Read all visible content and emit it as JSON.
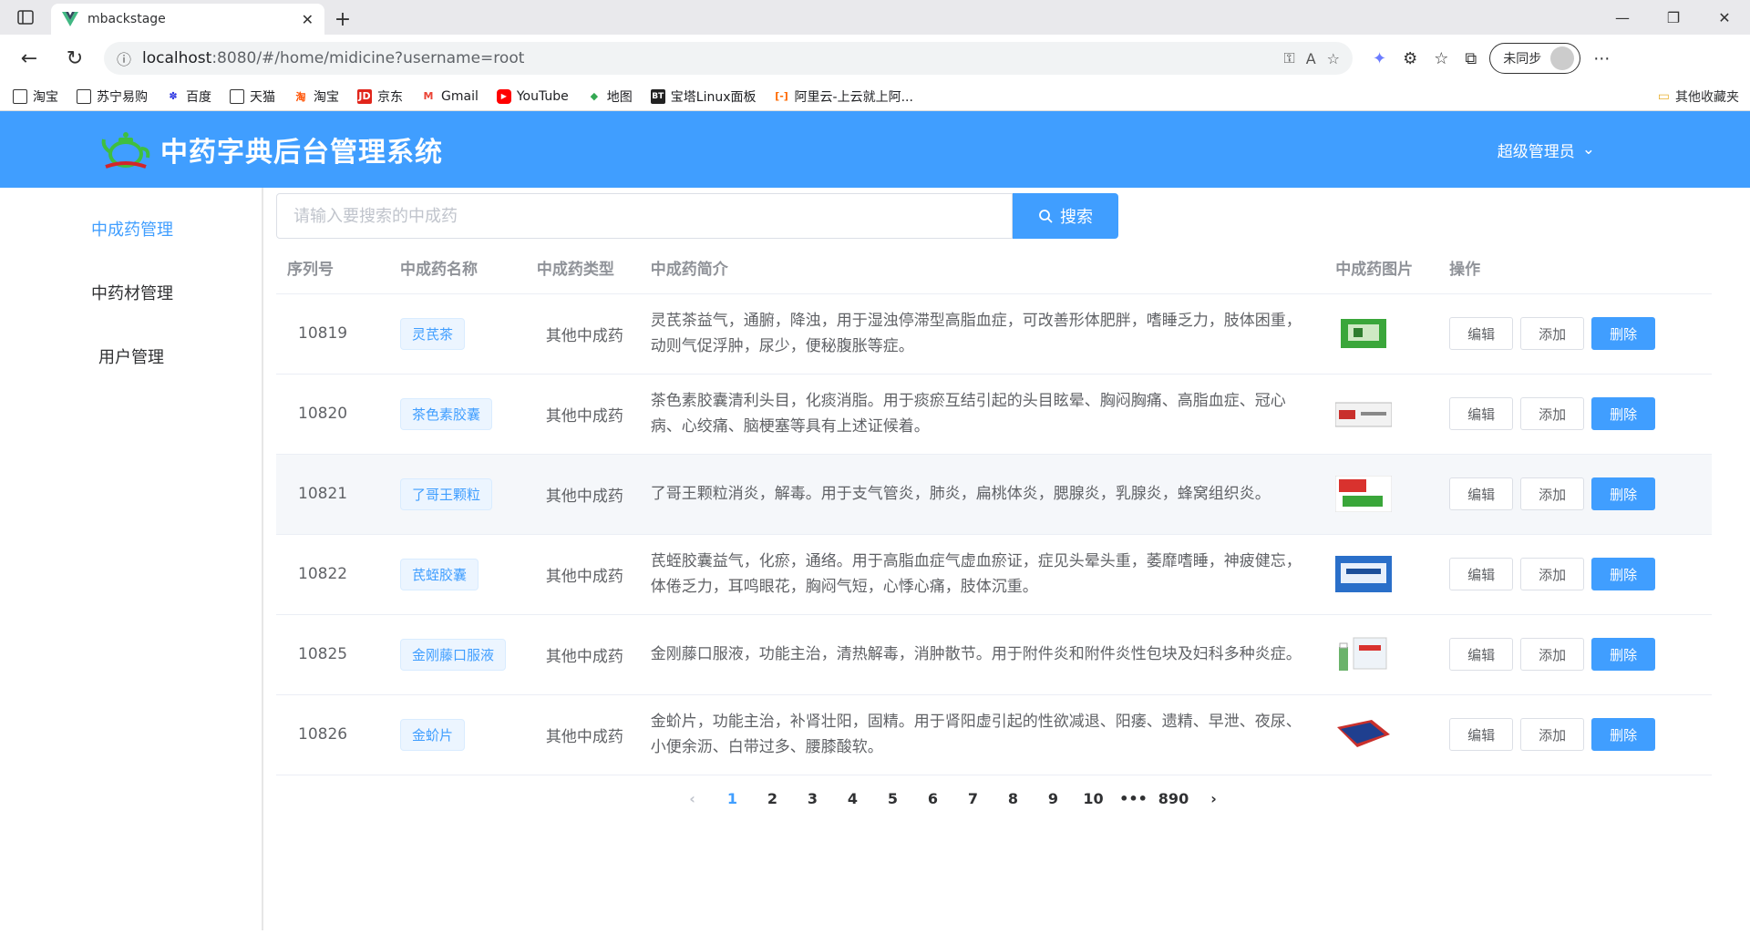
{
  "browser": {
    "tab_title": "mbackstage",
    "url_host": "localhost",
    "url_path": ":8080/#/home/midicine?username=root",
    "sync_label": "未同步",
    "bookmarks": [
      {
        "label": "淘宝",
        "icon": "page-icon"
      },
      {
        "label": "苏宁易购",
        "icon": "page-icon"
      },
      {
        "label": "百度",
        "icon": "baidu-icon"
      },
      {
        "label": "天猫",
        "icon": "page-icon"
      },
      {
        "label": "淘宝",
        "icon": "taobao-icon"
      },
      {
        "label": "京东",
        "icon": "jd-icon"
      },
      {
        "label": "Gmail",
        "icon": "gmail-icon"
      },
      {
        "label": "YouTube",
        "icon": "youtube-icon"
      },
      {
        "label": "地图",
        "icon": "map-icon"
      },
      {
        "label": "宝塔Linux面板",
        "icon": "bt-icon"
      },
      {
        "label": "阿里云-上云就上阿...",
        "icon": "aliyun-icon"
      }
    ],
    "other_bookmarks": "其他收藏夹"
  },
  "app": {
    "title": "中药字典后台管理系统",
    "user_menu": "超级管理员"
  },
  "sidebar": {
    "items": [
      {
        "label": "中成药管理",
        "active": true
      },
      {
        "label": "中药材管理",
        "active": false
      },
      {
        "label": "用户管理",
        "active": false
      }
    ]
  },
  "search": {
    "placeholder": "请输入要搜索的中成药",
    "button_label": "搜索"
  },
  "table": {
    "headers": [
      "序列号",
      "中成药名称",
      "中成药类型",
      "中成药简介",
      "中成药图片",
      "操作"
    ],
    "rows": [
      {
        "id": "10819",
        "name": "灵芪茶",
        "type": "其他中成药",
        "desc": "灵芪茶益气，通腑，降浊，用于湿浊停滞型高脂血症，可改善形体肥胖，嗜睡乏力，肢体困重，动则气促浮肿，尿少，便秘腹胀等症。"
      },
      {
        "id": "10820",
        "name": "茶色素胶囊",
        "type": "其他中成药",
        "desc": "茶色素胶囊清利头目，化痰消脂。用于痰瘀互结引起的头目眩晕、胸闷胸痛、高脂血症、冠心病、心绞痛、脑梗塞等具有上述证候着。"
      },
      {
        "id": "10821",
        "name": "了哥王颗粒",
        "type": "其他中成药",
        "desc": "了哥王颗粒消炎，解毒。用于支气管炎，肺炎，扁桃体炎，腮腺炎，乳腺炎，蜂窝组织炎。"
      },
      {
        "id": "10822",
        "name": "芪蛭胶囊",
        "type": "其他中成药",
        "desc": "芪蛭胶囊益气，化瘀，通络。用于高脂血症气虚血瘀证，症见头晕头重，萎靡嗜睡，神疲健忘，体倦乏力，耳鸣眼花，胸闷气短，心悸心痛，肢体沉重。"
      },
      {
        "id": "10825",
        "name": "金刚藤口服液",
        "type": "其他中成药",
        "desc": "金刚藤口服液，功能主治，清热解毒，消肿散节。用于附件炎和附件炎性包块及妇科多种炎症。"
      },
      {
        "id": "10826",
        "name": "金蚧片",
        "type": "其他中成药",
        "desc": "金蚧片，功能主治，补肾壮阳，固精。用于肾阳虚引起的性欲减退、阳痿、遗精、早泄、夜尿、小便余沥、白带过多、腰膝酸软。"
      }
    ],
    "ops": {
      "edit": "编辑",
      "add": "添加",
      "delete": "删除"
    }
  },
  "pagination": {
    "pages": [
      "1",
      "2",
      "3",
      "4",
      "5",
      "6",
      "7",
      "8",
      "9",
      "10",
      "•••",
      "890"
    ],
    "current": "1"
  },
  "colors": {
    "primary": "#409eff",
    "header_bg": "#409eff"
  }
}
